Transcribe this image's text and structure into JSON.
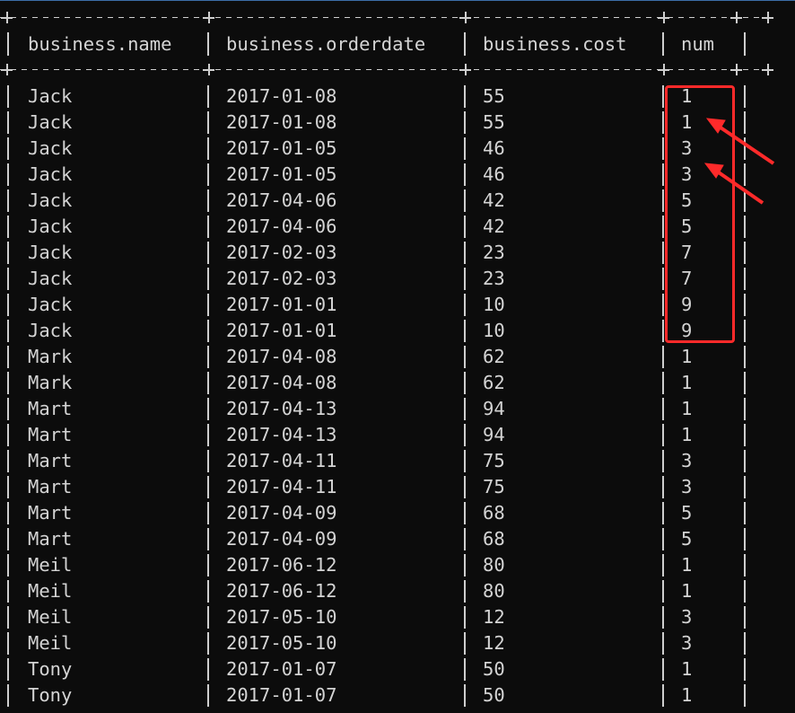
{
  "table": {
    "headers": {
      "name": "business.name",
      "orderdate": "business.orderdate",
      "cost": "business.cost",
      "num": "num"
    },
    "rows": [
      {
        "name": "Jack",
        "orderdate": "2017-01-08",
        "cost": "55",
        "num": "1"
      },
      {
        "name": "Jack",
        "orderdate": "2017-01-08",
        "cost": "55",
        "num": "1"
      },
      {
        "name": "Jack",
        "orderdate": "2017-01-05",
        "cost": "46",
        "num": "3"
      },
      {
        "name": "Jack",
        "orderdate": "2017-01-05",
        "cost": "46",
        "num": "3"
      },
      {
        "name": "Jack",
        "orderdate": "2017-04-06",
        "cost": "42",
        "num": "5"
      },
      {
        "name": "Jack",
        "orderdate": "2017-04-06",
        "cost": "42",
        "num": "5"
      },
      {
        "name": "Jack",
        "orderdate": "2017-02-03",
        "cost": "23",
        "num": "7"
      },
      {
        "name": "Jack",
        "orderdate": "2017-02-03",
        "cost": "23",
        "num": "7"
      },
      {
        "name": "Jack",
        "orderdate": "2017-01-01",
        "cost": "10",
        "num": "9"
      },
      {
        "name": "Jack",
        "orderdate": "2017-01-01",
        "cost": "10",
        "num": "9"
      },
      {
        "name": "Mark",
        "orderdate": "2017-04-08",
        "cost": "62",
        "num": "1"
      },
      {
        "name": "Mark",
        "orderdate": "2017-04-08",
        "cost": "62",
        "num": "1"
      },
      {
        "name": "Mart",
        "orderdate": "2017-04-13",
        "cost": "94",
        "num": "1"
      },
      {
        "name": "Mart",
        "orderdate": "2017-04-13",
        "cost": "94",
        "num": "1"
      },
      {
        "name": "Mart",
        "orderdate": "2017-04-11",
        "cost": "75",
        "num": "3"
      },
      {
        "name": "Mart",
        "orderdate": "2017-04-11",
        "cost": "75",
        "num": "3"
      },
      {
        "name": "Mart",
        "orderdate": "2017-04-09",
        "cost": "68",
        "num": "5"
      },
      {
        "name": "Mart",
        "orderdate": "2017-04-09",
        "cost": "68",
        "num": "5"
      },
      {
        "name": "Meil",
        "orderdate": "2017-06-12",
        "cost": "80",
        "num": "1"
      },
      {
        "name": "Meil",
        "orderdate": "2017-06-12",
        "cost": "80",
        "num": "1"
      },
      {
        "name": "Meil",
        "orderdate": "2017-05-10",
        "cost": "12",
        "num": "3"
      },
      {
        "name": "Meil",
        "orderdate": "2017-05-10",
        "cost": "12",
        "num": "3"
      },
      {
        "name": "Tony",
        "orderdate": "2017-01-07",
        "cost": "50",
        "num": "1"
      },
      {
        "name": "Tony",
        "orderdate": "2017-01-07",
        "cost": "50",
        "num": "1"
      }
    ]
  },
  "colors": {
    "background": "#0c0c0c",
    "text": "#d4d4d4",
    "annotation": "#ff2a2a"
  }
}
